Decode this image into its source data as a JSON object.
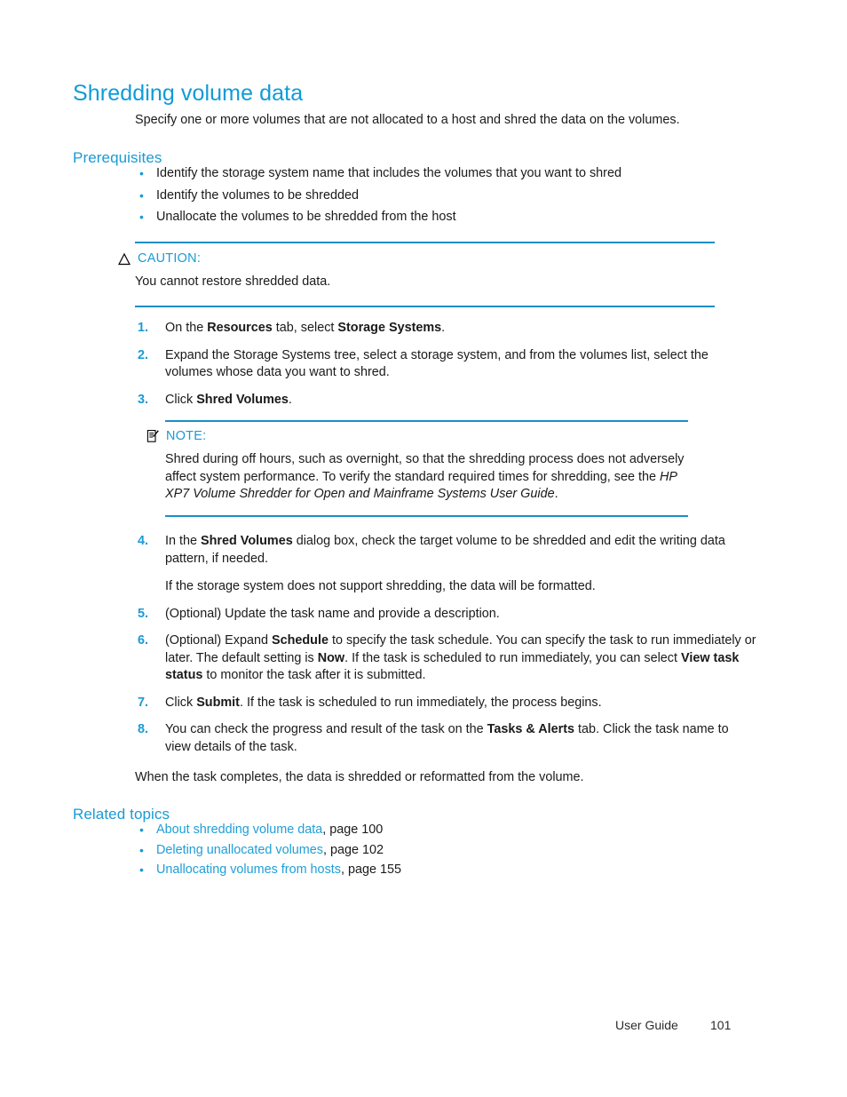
{
  "document": {
    "title": "Shredding volume data",
    "intro": "Specify one or more volumes that are not allocated to a host and shred the data on the volumes."
  },
  "prerequisites": {
    "heading": "Prerequisites",
    "items": [
      "Identify the storage system name that includes the volumes that you want to shred",
      "Identify the volumes to be shredded",
      "Unallocate the volumes to be shredded from the host"
    ]
  },
  "caution": {
    "icon": "warning-triangle-icon",
    "title": "CAUTION:",
    "body": "You cannot restore shredded data."
  },
  "note": {
    "icon": "note-clipboard-icon",
    "title": "NOTE:",
    "body_part1": "Shred during off hours, such as overnight, so that the shredding process does not adversely affect system performance. To verify the standard required times for shredding, see the ",
    "body_italic": "HP XP7 Volume Shredder for Open and Mainframe Systems User Guide",
    "body_part2": "."
  },
  "steps": [
    {
      "number": "1.",
      "parts": [
        {
          "text": "On the ",
          "bold": false
        },
        {
          "text": "Resources",
          "bold": true
        },
        {
          "text": " tab, select ",
          "bold": false
        },
        {
          "text": "Storage Systems",
          "bold": true
        },
        {
          "text": ".",
          "bold": false
        }
      ]
    },
    {
      "number": "2.",
      "parts": [
        {
          "text": "Expand the Storage Systems tree, select a storage system, and from the volumes list, select the volumes whose data you want to shred.",
          "bold": false
        }
      ]
    },
    {
      "number": "3.",
      "parts": [
        {
          "text": "Click ",
          "bold": false
        },
        {
          "text": "Shred Volumes",
          "bold": true
        },
        {
          "text": ".",
          "bold": false
        }
      ]
    },
    {
      "number": "4.",
      "parts": [
        {
          "text": "In the ",
          "bold": false
        },
        {
          "text": "Shred Volumes",
          "bold": true
        },
        {
          "text": " dialog box, check the target volume to be shredded and edit the writing data pattern, if needed.",
          "bold": false
        }
      ],
      "sub": "If the storage system does not support shredding, the data will be formatted."
    },
    {
      "number": "5.",
      "parts": [
        {
          "text": "(Optional) Update the task name and provide a description.",
          "bold": false
        }
      ]
    },
    {
      "number": "6.",
      "parts": [
        {
          "text": "(Optional) Expand ",
          "bold": false
        },
        {
          "text": "Schedule",
          "bold": true
        },
        {
          "text": " to specify the task schedule. You can specify the task to run immediately or later. The default setting is ",
          "bold": false
        },
        {
          "text": "Now",
          "bold": true
        },
        {
          "text": ". If the task is scheduled to run immediately, you can select ",
          "bold": false
        },
        {
          "text": "View task status",
          "bold": true
        },
        {
          "text": " to monitor the task after it is submitted.",
          "bold": false
        }
      ]
    },
    {
      "number": "7.",
      "parts": [
        {
          "text": "Click ",
          "bold": false
        },
        {
          "text": "Submit",
          "bold": true
        },
        {
          "text": ". If the task is scheduled to run immediately, the process begins.",
          "bold": false
        }
      ]
    },
    {
      "number": "8.",
      "parts": [
        {
          "text": "You can check the progress and result of the task on the ",
          "bold": false
        },
        {
          "text": "Tasks & Alerts",
          "bold": true
        },
        {
          "text": " tab. Click the task name to view details of the task.",
          "bold": false
        }
      ]
    }
  ],
  "closing_paragraph": "When the task completes, the data is shredded or reformatted from the volume.",
  "related_topics": {
    "heading": "Related topics",
    "items": [
      {
        "link": "About shredding volume data",
        "page": ", page 100"
      },
      {
        "link": "Deleting unallocated volumes",
        "page": ", page 102"
      },
      {
        "link": "Unallocating volumes from hosts",
        "page": ", page 155"
      }
    ]
  },
  "footer": {
    "label": "User Guide",
    "page_number": "101"
  },
  "colors": {
    "heading_blue": "#0f9bd7",
    "accent_blue": "#1a9ad4",
    "rule_blue": "#1a8fc6",
    "link_blue": "#1f9ed6",
    "body_black": "#1a1a1a"
  }
}
